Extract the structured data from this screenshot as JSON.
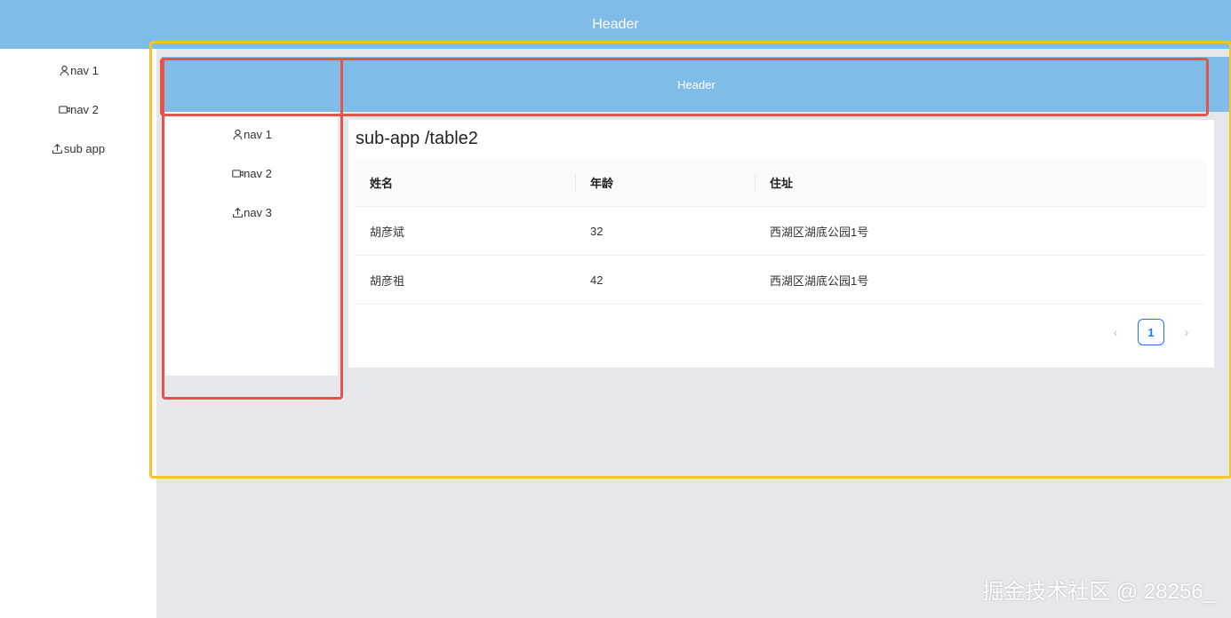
{
  "main": {
    "header": {
      "title": "Header"
    },
    "nav": [
      {
        "icon": "user-icon",
        "label": "nav 1"
      },
      {
        "icon": "video-camera-icon",
        "label": "nav 2"
      },
      {
        "icon": "upload-icon",
        "label": "sub app"
      }
    ]
  },
  "sub_app": {
    "header": {
      "title": "Header"
    },
    "nav": [
      {
        "icon": "user-icon",
        "label": "nav 1"
      },
      {
        "icon": "video-camera-icon",
        "label": "nav 2"
      },
      {
        "icon": "upload-icon",
        "label": "nav 3"
      }
    ],
    "page_title": "sub-app /table2",
    "table": {
      "columns": [
        "姓名",
        "年龄",
        "住址"
      ],
      "rows": [
        [
          "胡彦斌",
          "32",
          "西湖区湖底公园1号"
        ],
        [
          "胡彦祖",
          "42",
          "西湖区湖底公园1号"
        ]
      ]
    },
    "pagination": {
      "prev": "‹",
      "current_page": "1",
      "next": "›"
    }
  },
  "watermark": "掘金技术社区 @ 28256_",
  "colors": {
    "header_bg": "#7fbce8",
    "content_bg": "#e5e7eb",
    "primary": "#1677ff",
    "annotation_yellow": "#f7c325",
    "annotation_red": "#e5534b"
  }
}
